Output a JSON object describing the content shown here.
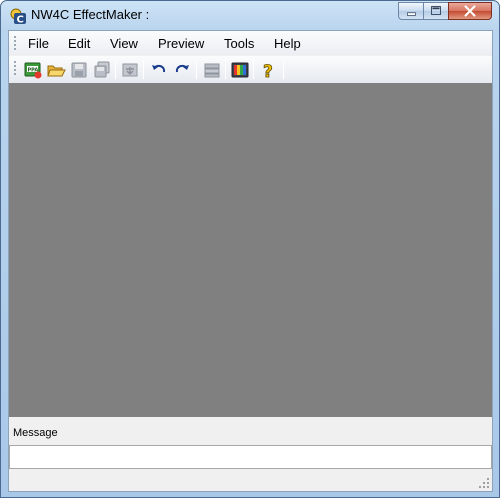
{
  "window": {
    "title": "NW4C EffectMaker :"
  },
  "menubar": {
    "items": [
      {
        "label": "File"
      },
      {
        "label": "Edit"
      },
      {
        "label": "View"
      },
      {
        "label": "Preview"
      },
      {
        "label": "Tools"
      },
      {
        "label": "Help"
      }
    ]
  },
  "toolbar": {
    "buttons": [
      {
        "icon": "new-effect-icon",
        "enabled": true
      },
      {
        "icon": "open-folder-icon",
        "enabled": true
      },
      {
        "icon": "save-icon",
        "enabled": false
      },
      {
        "icon": "save-all-icon",
        "enabled": false
      },
      {
        "icon": "export-icon",
        "enabled": false
      },
      {
        "icon": "undo-icon",
        "enabled": true
      },
      {
        "icon": "redo-icon",
        "enabled": true
      },
      {
        "icon": "layers-icon",
        "enabled": false
      },
      {
        "icon": "color-picker-icon",
        "enabled": true
      },
      {
        "icon": "help-icon",
        "enabled": true
      }
    ]
  },
  "message_panel": {
    "label": "Message",
    "value": ""
  },
  "colors": {
    "workspace": "#808080",
    "titlebar": "#b9d4ee",
    "close_button": "#c44a33"
  }
}
